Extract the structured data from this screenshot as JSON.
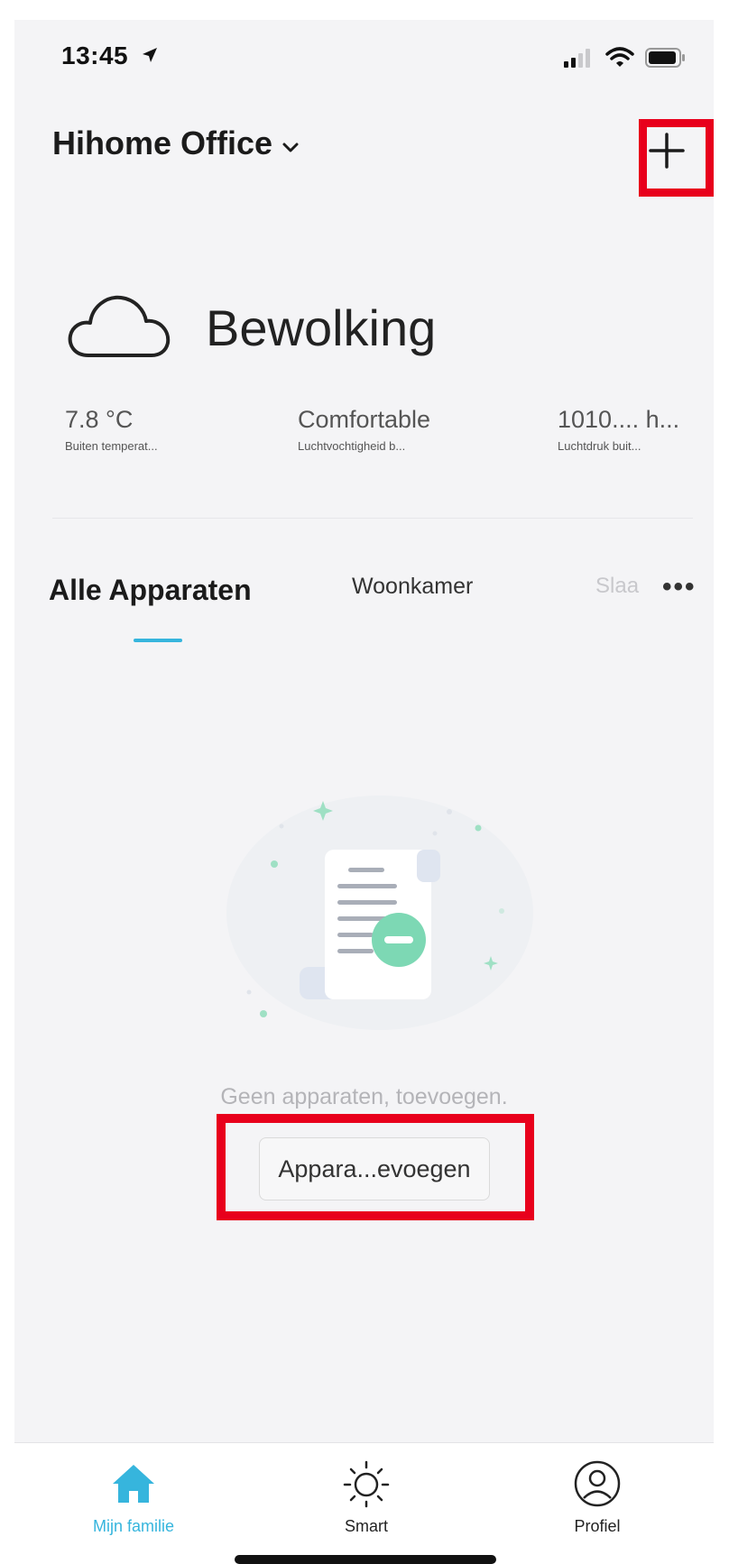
{
  "status_bar": {
    "time": "13:45",
    "location_icon": "location-arrow-icon",
    "icons": [
      "signal-icon",
      "wifi-icon",
      "battery-icon"
    ]
  },
  "header": {
    "home_name": "Hihome Office",
    "dropdown_icon": "chevron-down-icon",
    "add_label": "+"
  },
  "weather": {
    "icon": "cloud-icon",
    "condition": "Bewolking",
    "stats": [
      {
        "value": "7.8 °C",
        "label": "Buiten temperat..."
      },
      {
        "value": "Comfortable",
        "label": "Luchtvochtigheid b..."
      },
      {
        "value": "1010.... h...",
        "label": "Luchtdruk buit..."
      }
    ]
  },
  "tabs": {
    "items": [
      {
        "label": "Alle Apparaten",
        "active": true
      },
      {
        "label": "Woonkamer",
        "active": false
      },
      {
        "label": "Slaa",
        "active": false
      }
    ],
    "more_label": "•••"
  },
  "empty_state": {
    "illustration_icon": "empty-document-icon",
    "message": "Geen apparaten, toevoegen.",
    "button_label": "Appara...evoegen"
  },
  "bottom_nav": {
    "items": [
      {
        "label": "Mijn familie",
        "icon": "home-icon",
        "active": true
      },
      {
        "label": "Smart",
        "icon": "sun-icon",
        "active": false
      },
      {
        "label": "Profiel",
        "icon": "profile-icon",
        "active": false
      }
    ]
  },
  "colors": {
    "accent": "#36b5dd",
    "highlight": "#e8001c",
    "background": "#f4f4f6",
    "illustration_green": "#7dd8b4"
  }
}
